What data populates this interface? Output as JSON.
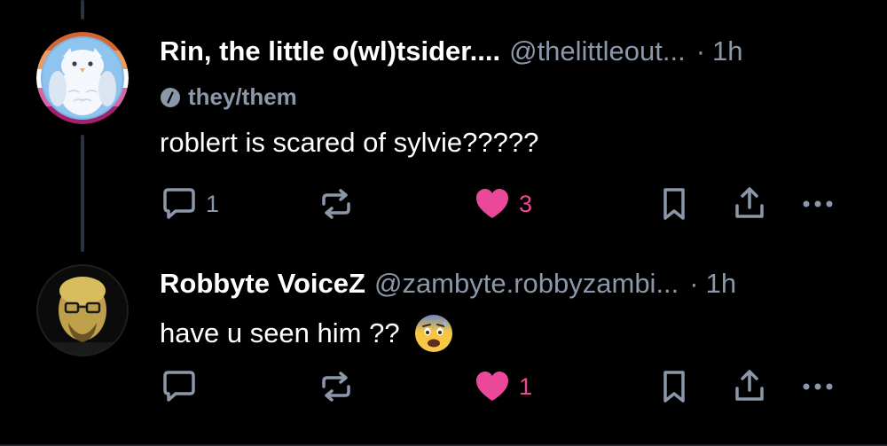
{
  "colors": {
    "background": "#000000",
    "muted": "#8b98a9",
    "like": "#ec4899",
    "thread_line": "#2b3340"
  },
  "posts": [
    {
      "display_name": "Rin, the little o(wl)tsider....",
      "handle": "@thelittleout...",
      "dot": "·",
      "time": "1h",
      "pronouns": "they/them",
      "text": "roblert is scared of sylvie?????",
      "reply_count": "1",
      "like_count": "3",
      "liked": true,
      "avatar": "owl-avatar"
    },
    {
      "display_name": "Robbyte VoiceZ",
      "handle": "@zambyte.robbyzambi...",
      "dot": "·",
      "time": "1h",
      "text": "have u seen him ??",
      "emoji": "fearful-face-emoji",
      "like_count": "1",
      "liked": true,
      "avatar": "person-avatar"
    }
  ]
}
